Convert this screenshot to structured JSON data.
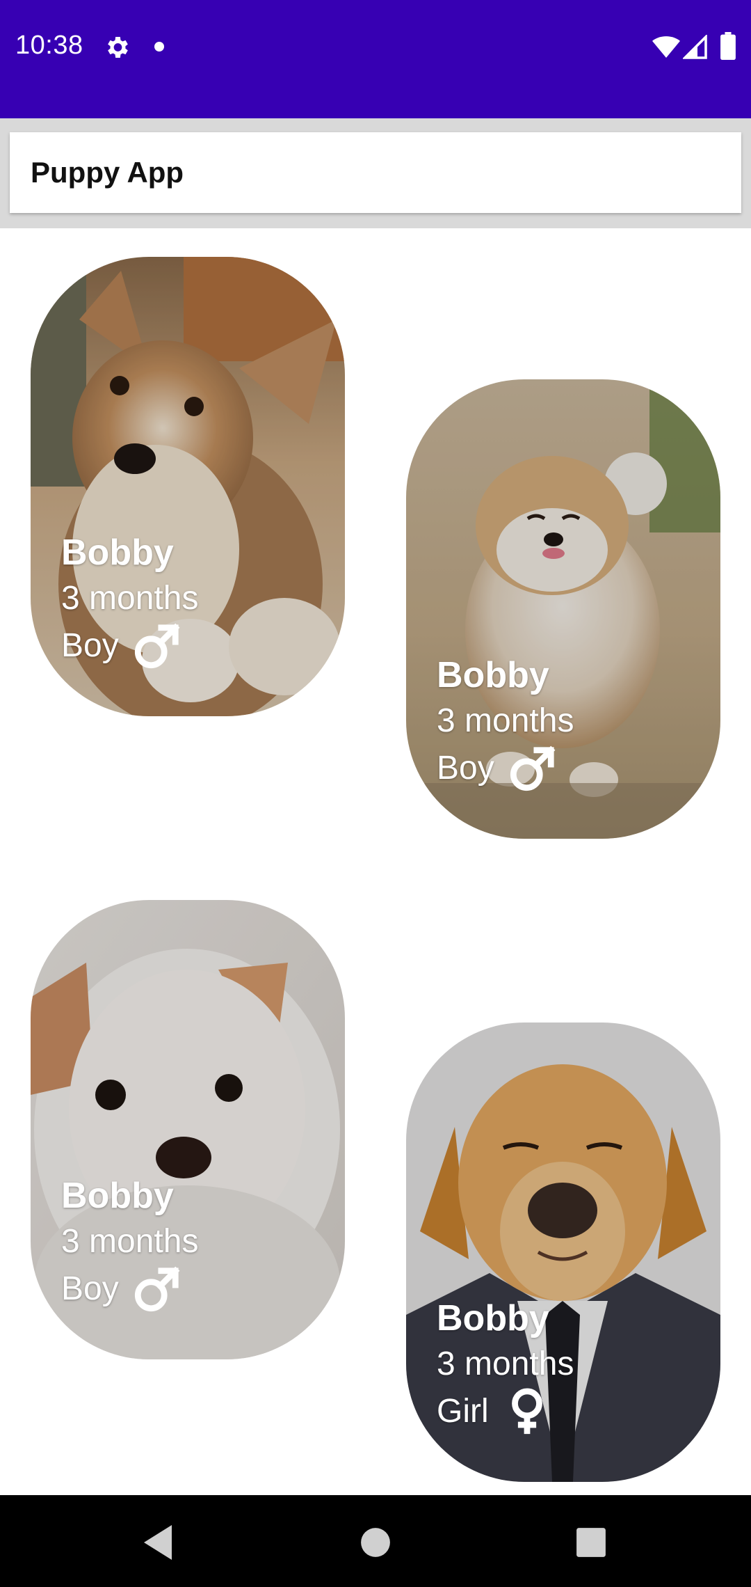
{
  "status_bar": {
    "time": "10:38",
    "icons": [
      "settings-gear-icon",
      "notification-dot-icon",
      "wifi-icon",
      "cell-signal-icon",
      "battery-icon"
    ],
    "background": "#3700b3"
  },
  "app_bar": {
    "title": "Puppy App"
  },
  "puppies": [
    {
      "name": "Bobby",
      "age": "3 months",
      "gender": "Boy",
      "gender_icon": "male-icon",
      "photo": "corgi puppy photo"
    },
    {
      "name": "Bobby",
      "age": "3 months",
      "gender": "Boy",
      "gender_icon": "male-icon",
      "photo": "pomeranian puppy photo"
    },
    {
      "name": "Bobby",
      "age": "3 months",
      "gender": "Boy",
      "gender_icon": "male-icon",
      "photo": "white puppy photo"
    },
    {
      "name": "Bobby",
      "age": "3 months",
      "gender": "Girl",
      "gender_icon": "female-icon",
      "photo": "golden retriever in suit photo"
    }
  ],
  "nav_bar": {
    "buttons": [
      "back-icon",
      "home-icon",
      "recents-icon"
    ]
  }
}
